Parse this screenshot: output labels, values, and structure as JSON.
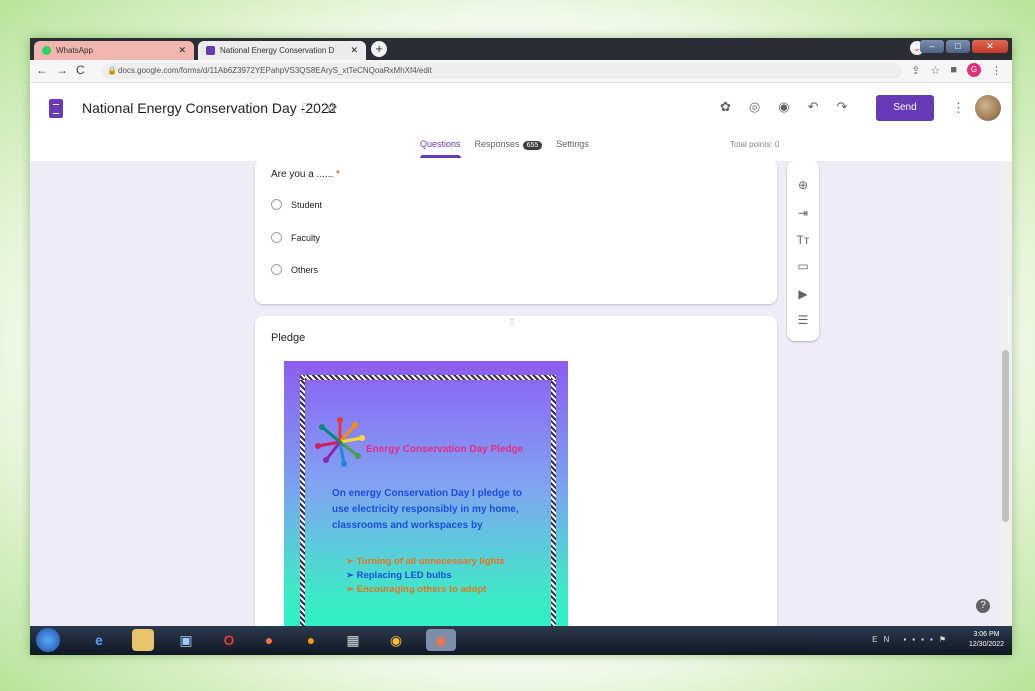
{
  "browser": {
    "tabs": [
      {
        "label": "WhatsApp",
        "favicon_color": "#25d366"
      },
      {
        "label": "National Energy Conservation D",
        "favicon_color": "#673ab7"
      }
    ],
    "new_tab_symbol": "+",
    "url": "docs.google.com/forms/d/11Ab6Z3972YEPahpVS3QS8EAryS_xtTeCNQoaRxMhXf4/edit",
    "profile_initial": "G"
  },
  "form": {
    "title": "National Energy Conservation Day -2022",
    "send_label": "Send",
    "tabs": {
      "questions": "Questions",
      "responses": "Responses",
      "responses_count": "655",
      "settings": "Settings"
    },
    "total_points": "Total points: 0"
  },
  "question": {
    "text": "Are you a ......",
    "required_mark": "*",
    "options": [
      "Student",
      "Faculty",
      "Others"
    ]
  },
  "pledge_section": {
    "title": "Pledge",
    "image": {
      "heading": "Energy Conservation Day Pledge",
      "body": "On energy Conservation Day I pledge to use electricity responsibly in my home, classrooms and workspaces by",
      "bullets": [
        "Turning of all unnecessary lights",
        "Replacing LED bulbs",
        "Encouraging others to adopt"
      ]
    }
  },
  "taskbar": {
    "lang": "EN",
    "time": "3:06 PM",
    "date": "12/30/2022"
  },
  "colors": {
    "accent": "#673ab7",
    "background": "#f0ebf8"
  }
}
